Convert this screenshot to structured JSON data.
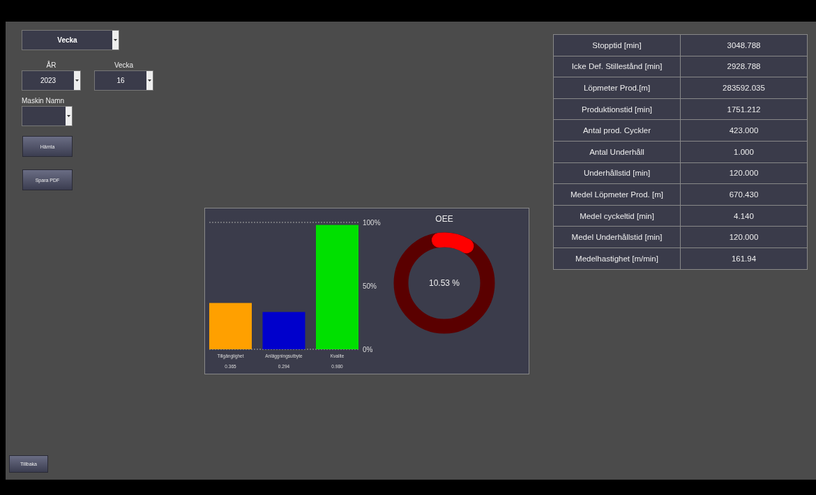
{
  "period_select": {
    "value": "Vecka"
  },
  "year_select": {
    "label": "ÅR",
    "value": "2023"
  },
  "week_select": {
    "label": "Vecka",
    "value": "16"
  },
  "machine_select": {
    "label": "Maskin Namn"
  },
  "buttons": [
    "Hämta",
    "Spara PDF"
  ],
  "chart": {
    "chart_data": {
      "type": "bar",
      "stacked": true,
      "series": [
        {
          "name": "Tillgänglighet",
          "color": "#ffa000",
          "values": [
            0.365,
            null,
            null
          ]
        },
        {
          "name": "Anläggningsutbyte",
          "color": "#0000cc",
          "values": [
            null,
            0.294,
            null
          ]
        },
        {
          "name": "Kvalite",
          "color": "#00e000",
          "values": [
            null,
            null,
            0.98
          ]
        }
      ],
      "ylim": [
        0,
        1
      ],
      "yticks": [
        {
          "value": 0,
          "label": "0%"
        },
        {
          "value": 0.5,
          "label": "50%"
        },
        {
          "value": 1,
          "label": "100%"
        }
      ],
      "value_labels": [
        "0.365",
        "0.294",
        "0.980"
      ]
    }
  },
  "oee": {
    "title": "OEE",
    "reading": "10.53 %",
    "level": 0.1053
  },
  "stats": [
    {
      "label": "Stopptid [min]",
      "value": "3048.788"
    },
    {
      "label": "Icke Def. Stillestånd [min]",
      "value": "2928.788"
    },
    {
      "label": "Löpmeter Prod.[m]",
      "value": "283592.035"
    },
    {
      "label": "Produktionstid [min]",
      "value": "1751.212"
    },
    {
      "label": "Antal prod. Cyckler",
      "value": "423.000"
    },
    {
      "label": "Antal Underhåll",
      "value": "1.000"
    },
    {
      "label": "Underhållstid [min]",
      "value": "120.000"
    },
    {
      "label": "Medel Löpmeter Prod.  [m]",
      "value": "670.430"
    },
    {
      "label": "Medel cyckeltid [min]",
      "value": "4.140"
    },
    {
      "label": "Medel Underhållstid [min]",
      "value": "120.000"
    },
    {
      "label": "Medelhastighet [m/min]",
      "value": "161.94"
    }
  ],
  "back_button": "Tillbaka"
}
